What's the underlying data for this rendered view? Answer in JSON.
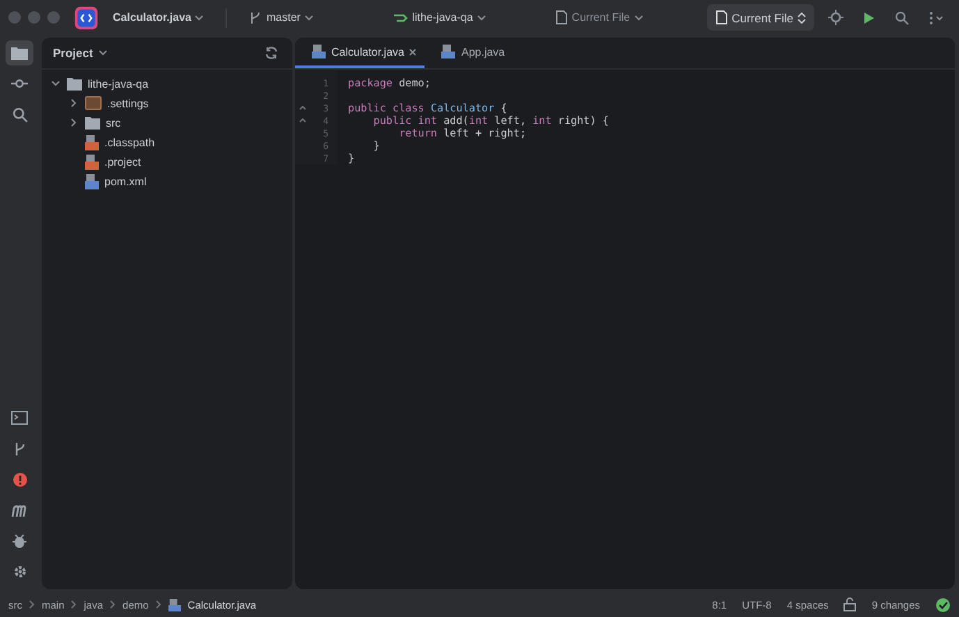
{
  "title_bar": {
    "project": "Calculator.java",
    "branch": "master",
    "module": "lithe-java-qa",
    "config": "Current File",
    "run_config": "Current File"
  },
  "tool_strip_top": [
    {
      "kind": "project",
      "selected": true
    },
    {
      "kind": "commit",
      "selected": false
    },
    {
      "kind": "search",
      "selected": false
    }
  ],
  "tool_strip_bottom": [
    {
      "kind": "terminal"
    },
    {
      "kind": "git"
    },
    {
      "kind": "problems"
    },
    {
      "kind": "maven"
    },
    {
      "kind": "debug"
    },
    {
      "kind": "settings"
    }
  ],
  "project_panel": {
    "title": "Project",
    "tree": [
      {
        "label": "lithe-java-qa",
        "kind": "folder",
        "expanded": true,
        "children": [
          {
            "label": ".settings",
            "kind": "settings-folder",
            "expanded": false
          },
          {
            "label": "src",
            "kind": "folder",
            "expanded": false
          },
          {
            "label": ".classpath",
            "kind": "config-file"
          },
          {
            "label": ".project",
            "kind": "config-file"
          },
          {
            "label": "pom.xml",
            "kind": "xml-file"
          }
        ]
      }
    ]
  },
  "editor": {
    "tabs": [
      {
        "label": "Calculator.java",
        "selected": true
      },
      {
        "label": "App.java",
        "selected": false
      }
    ],
    "lines": [
      {
        "number": "1",
        "fold": false,
        "tokens": [
          {
            "text": "package",
            "kind": "keyword"
          },
          {
            "text": " demo;",
            "kind": "plain"
          }
        ]
      },
      {
        "number": "2",
        "fold": false
      },
      {
        "number": "3",
        "fold": true,
        "tokens": [
          {
            "text": "public class ",
            "kind": "keyword"
          },
          {
            "text": "Calculator",
            "kind": "class"
          },
          {
            "text": " {",
            "kind": "plain"
          }
        ]
      },
      {
        "number": "4",
        "fold": true,
        "tokens": [
          {
            "text": "    public int",
            "kind": "keyword"
          },
          {
            "text": " add(",
            "kind": "plain"
          },
          {
            "text": "int",
            "kind": "keyword"
          },
          {
            "text": " left, ",
            "kind": "plain"
          },
          {
            "text": "int",
            "kind": "keyword"
          },
          {
            "text": " right) {",
            "kind": "plain"
          }
        ]
      },
      {
        "number": "5",
        "fold": false,
        "tokens": [
          {
            "text": "        return",
            "kind": "keyword"
          },
          {
            "text": " left + right;",
            "kind": "plain"
          }
        ]
      },
      {
        "number": "6",
        "fold": false,
        "tokens": [
          {
            "text": "    }",
            "kind": "plain"
          }
        ]
      },
      {
        "number": "7",
        "fold": false,
        "tokens": [
          {
            "text": "}",
            "kind": "plain"
          }
        ]
      }
    ]
  },
  "status_bar": {
    "breadcrumbs": [
      "src",
      "main",
      "java",
      "demo",
      "Calculator.java"
    ],
    "position": "8:1",
    "encoding": "UTF-8",
    "indent": "4 spaces",
    "changes": "9 changes"
  }
}
